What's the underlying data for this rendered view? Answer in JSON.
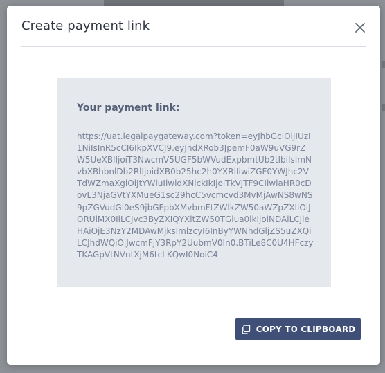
{
  "modal": {
    "title": "Create payment link",
    "close_icon": "close-icon",
    "link_heading": "Your payment link:",
    "link_url": "https://uat.legalpaygateway.com?token=eyJhbGciOiJIUzI1NiIsInR5cCI6IkpXVCJ9.eyJhdXRob3JpemF0aW9uVG9rZW5UeXBlIjoiT3NwcmV5UGF5bWVudExpbmtUb2tlbiIsImNvbXBhbnlDb2RlIjoidXB0b25hc2h0YXRlIiwiZGF0YWJhc2VTdWZmaXgiOiJtYWluIiwidXNlckIkIjoiTkVJTF9CIiwiaHR0cDovL3NjaGVtYXMueG1sc29hcC5vcmcvd3MvMjAwNS8wNS9pZGVudGl0eS9jbGFpbXMvbmFtZWlkZW50aWZpZXIiOiJORUlMX0IiLCJvc3ByZXIQYXltZW50TGlua0lkIjoiNDAiLCJleHAiOjE3NzY2MDAwMjksImlzcyI6InByYWNhdGljZS5uZXQiLCJhdWQiOiJwcmFjY3RpY2UubmV0In0.BTiLe8C0U4HFczyTKAGpVtNVntXjM6tcLKQwI0NoiC4",
    "copy_button": {
      "label": "COPY TO CLIPBOARD",
      "icon": "copy-icon"
    }
  },
  "colors": {
    "overlay": "#8d9196",
    "panel": "#e5e8ec",
    "heading": "#56617a",
    "link_text": "#7a8399",
    "button_bg": "#3f4f77"
  }
}
